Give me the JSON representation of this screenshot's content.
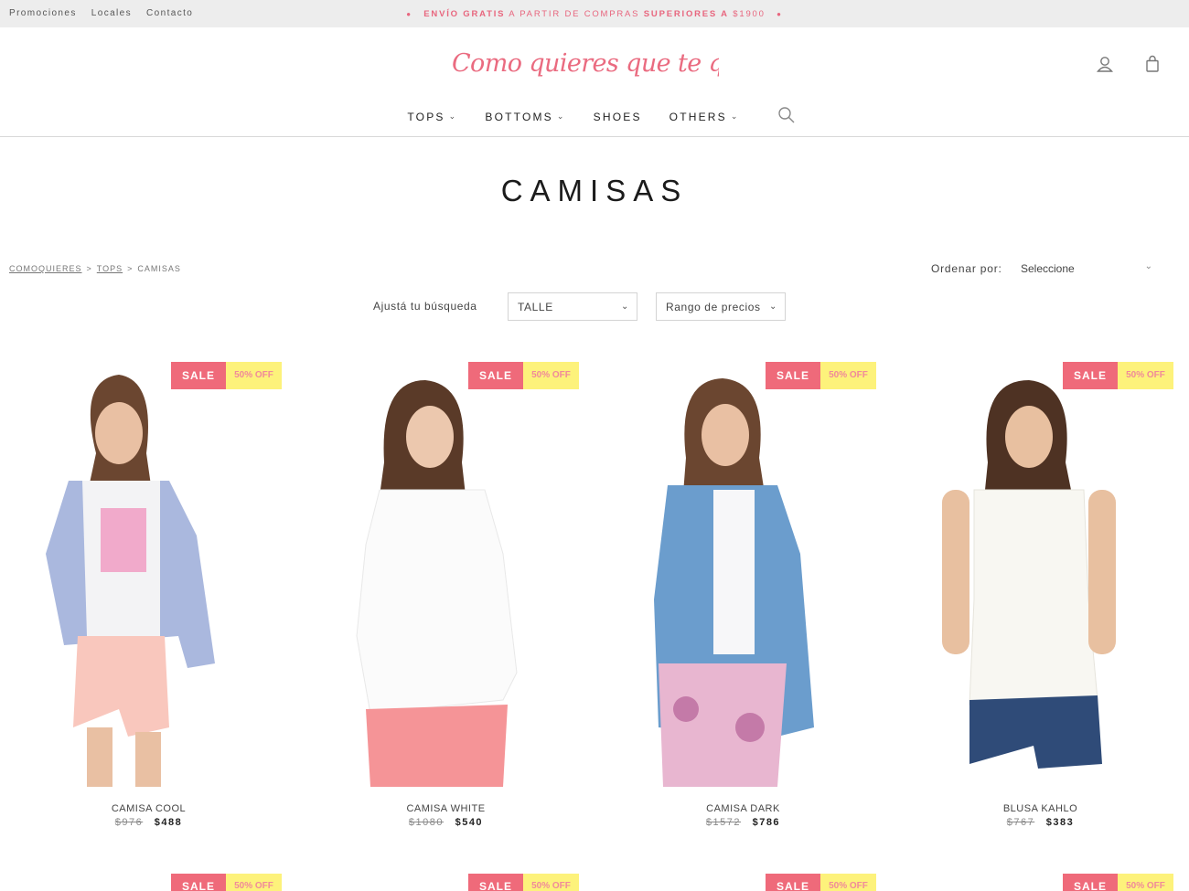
{
  "topbar": {
    "links": [
      "Promociones",
      "Locales",
      "Contacto"
    ],
    "promo": {
      "part1": "ENVÍO GRATIS",
      "part2": "A PARTIR DE COMPRAS",
      "part3": "SUPERIORES A",
      "part4": "$1900"
    }
  },
  "header": {
    "logo_text": "Como quieres que te quiera",
    "icons": [
      "user-icon",
      "shopping-bag-icon"
    ]
  },
  "nav": {
    "items": [
      {
        "label": "TOPS",
        "has_dropdown": true
      },
      {
        "label": "BOTTOMS",
        "has_dropdown": true
      },
      {
        "label": "SHOES",
        "has_dropdown": false
      },
      {
        "label": "OTHERS",
        "has_dropdown": true
      }
    ],
    "search_icon": "search-icon"
  },
  "page": {
    "title": "CAMISAS"
  },
  "breadcrumb": {
    "items": [
      "COMOQUIERES",
      "TOPS",
      "CAMISAS"
    ],
    "separator": ">"
  },
  "sort": {
    "label": "Ordenar por:",
    "selected": "Seleccione"
  },
  "filters": {
    "label": "Ajustá tu búsqueda",
    "size_value": "TALLE",
    "price_value": "Rango de precios"
  },
  "badge": {
    "sale": "SALE",
    "off": "50% OFF"
  },
  "products": [
    {
      "name": "CAMISA COOL",
      "old_price": "$976",
      "price": "$488"
    },
    {
      "name": "CAMISA WHITE",
      "old_price": "$1080",
      "price": "$540"
    },
    {
      "name": "CAMISA DARK",
      "old_price": "$1572",
      "price": "$786"
    },
    {
      "name": "BLUSA KAHLO",
      "old_price": "$767",
      "price": "$383"
    }
  ],
  "colors": {
    "brand_pink": "#ea6b80",
    "sale_red": "#ef6a7a",
    "off_yellow": "#fdf27b",
    "topbar_bg": "#ededed"
  }
}
